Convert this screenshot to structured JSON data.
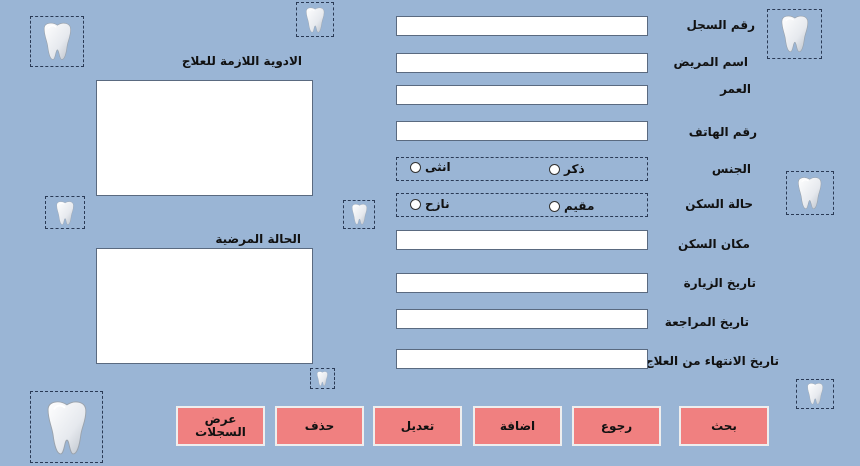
{
  "fields": {
    "record_no": "رقم السجل",
    "patient_name": "اسم المريض",
    "age": "العمر",
    "phone": "رقم الهاتف",
    "gender": "الجنس",
    "residence_status": "حالة السكن",
    "residence_place": "مكان السكن",
    "visit_date": "تاريخ الزيارة",
    "review_date": "تاريخ المراجعة",
    "treatment_end_date": "تاريخ الانتهاء من العلاج"
  },
  "gender_options": {
    "male": "ذكر",
    "female": "انثى"
  },
  "residence_options": {
    "resident": "مقيم",
    "outside": "نازح"
  },
  "medicines_label": "الادوية اللازمة للعلاج",
  "condition_label": "الحالة المرضية",
  "buttons": {
    "show_records": "عرض\nالسجلات",
    "delete": "حذف",
    "edit": "تعديل",
    "add": "اضافة",
    "back": "رجوع",
    "search": "بحث"
  },
  "icons": {
    "tooth": "tooth-icon"
  },
  "colors": {
    "background": "#9ab5d5",
    "button": "#f08080"
  }
}
